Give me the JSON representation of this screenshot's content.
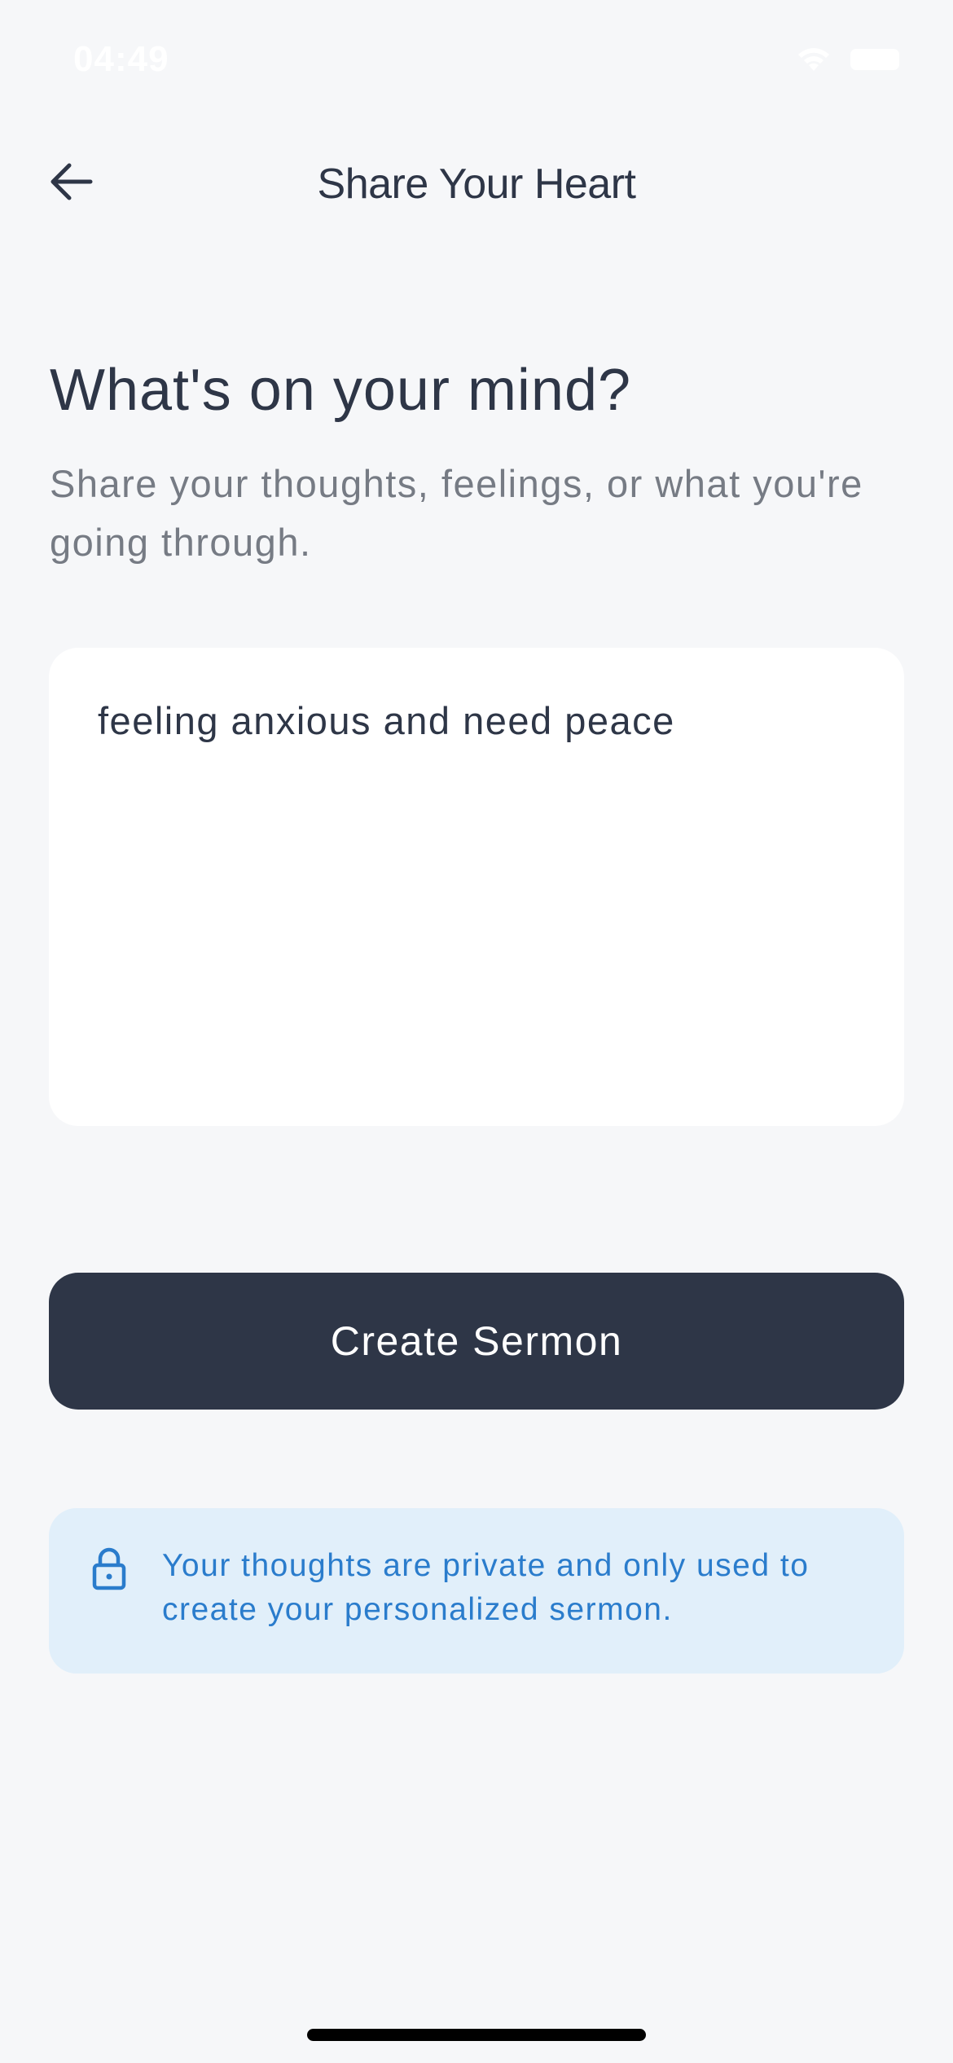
{
  "status_bar": {
    "time": "04:49"
  },
  "header": {
    "title": "Share Your Heart",
    "back_icon": "arrow-left-icon"
  },
  "prompt": {
    "heading": "What's on your mind?",
    "subheading": "Share your thoughts, feelings, or what you're going through."
  },
  "entry": {
    "value": "feeling anxious and need peace"
  },
  "actions": {
    "create_label": "Create Sermon"
  },
  "privacy": {
    "icon": "lock-icon",
    "text": "Your thoughts are private and only used to create your personalized sermon."
  },
  "colors": {
    "background": "#f6f7f9",
    "primary": "#2e3647",
    "muted_text": "#767b84",
    "info_background": "#e1effa",
    "info_text": "#2a7ccc"
  }
}
